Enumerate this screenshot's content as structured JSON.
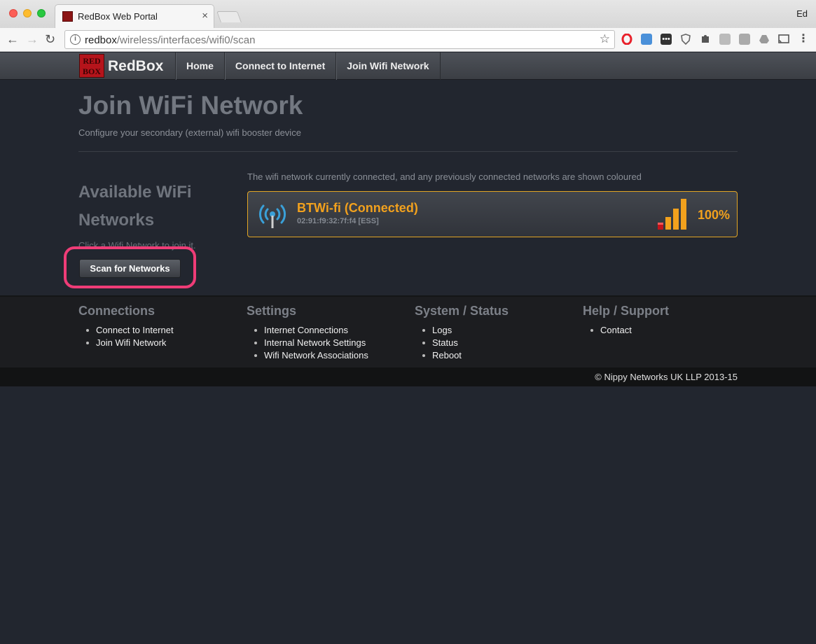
{
  "browser": {
    "tab_title": "RedBox Web Portal",
    "tab_close": "×",
    "user": "Ed",
    "url_host": "redbox",
    "url_path": "/wireless/interfaces/wifi0/scan",
    "back": "←",
    "forward": "→",
    "reload": "↻",
    "star": "☆"
  },
  "site": {
    "logo_text": "RedBox",
    "logo_box_line1": "RED",
    "logo_box_line2": "BOX",
    "nav": [
      "Home",
      "Connect to Internet",
      "Join Wifi Network"
    ]
  },
  "page": {
    "title": "Join WiFi Network",
    "subtitle": "Configure your secondary (external) wifi booster device"
  },
  "available": {
    "title": "Available WiFi Networks",
    "hint": "Click a Wifi Network to join it.",
    "scan_button": "Scan for Networks"
  },
  "networks": {
    "note": "The wifi network currently connected, and any previously connected networks are shown coloured",
    "items": [
      {
        "name": "BTWi-fi (Connected)",
        "details": "02:91:f9:32:7f:f4 [ESS]",
        "signal": "100%",
        "signal_level": 1.0
      }
    ]
  },
  "footer": {
    "columns": [
      {
        "title": "Connections",
        "links": [
          "Connect to Internet",
          "Join Wifi Network"
        ]
      },
      {
        "title": "Settings",
        "links": [
          "Internet Connections",
          "Internal Network Settings",
          "Wifi Network Associations"
        ]
      },
      {
        "title": "System / Status",
        "links": [
          "Logs",
          "Status",
          "Reboot"
        ]
      },
      {
        "title": "Help / Support",
        "links": [
          "Contact"
        ]
      }
    ],
    "copyright": "© Nippy Networks UK LLP 2013-15"
  },
  "colors": {
    "accent": "#f2a11d",
    "highlight": "#ef3c77",
    "background": "#22262f"
  }
}
